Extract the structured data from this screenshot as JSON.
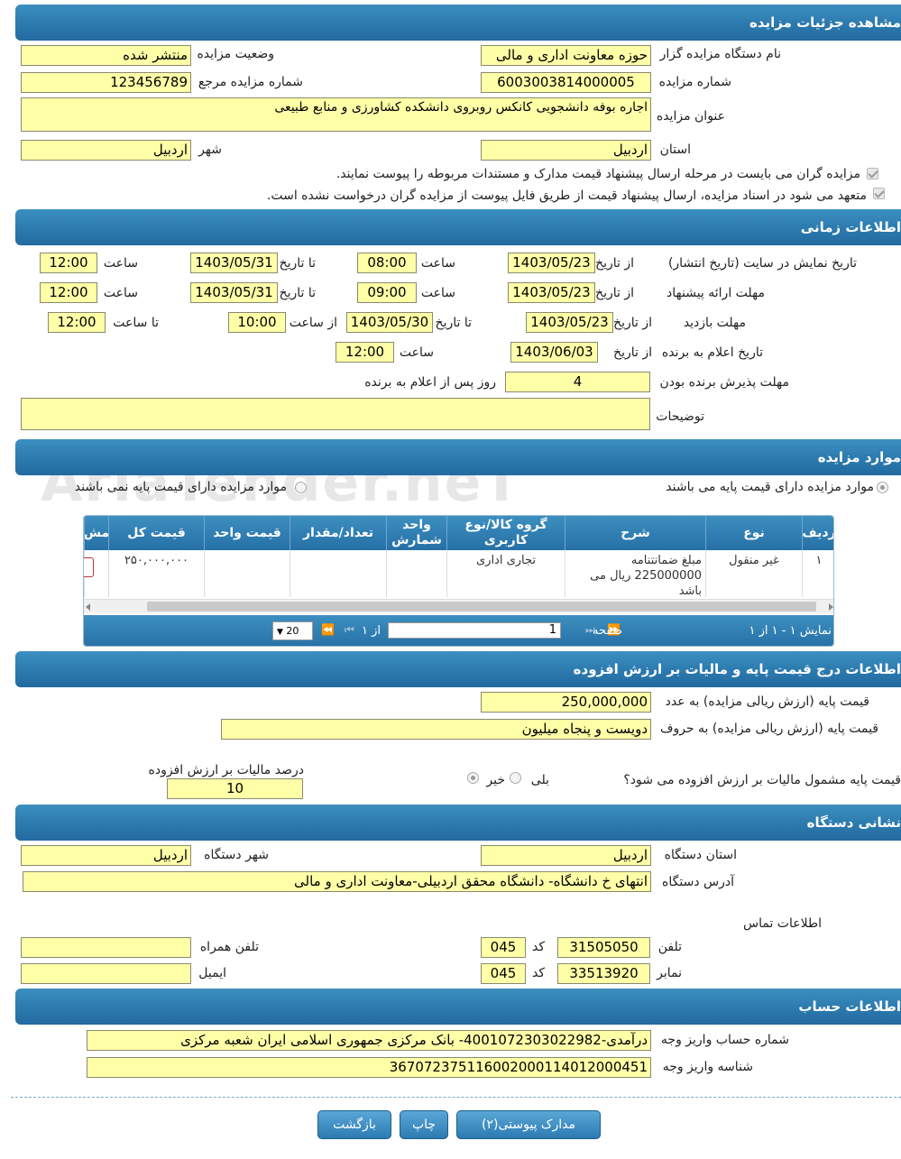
{
  "sections": {
    "details": "مشاهده جزئیات مزایده",
    "timing": "اطلاعات زمانی",
    "items": "موارد مزایده",
    "price": "اطلاعات درج قیمت پایه و مالیات بر ارزش افزوده",
    "address": "نشانی دستگاه",
    "account": "اطلاعات حساب"
  },
  "details": {
    "org_label": "نام دستگاه مزایده گزار",
    "org_value": "حوزه معاونت اداری و مالی",
    "status_label": "وضعیت مزایده",
    "status_value": "منتشر شده",
    "number_label": "شماره مزایده",
    "number_value": "6003003814000005",
    "ref_label": "شماره مزایده مرجع",
    "ref_value": "123456789",
    "title_label": "عنوان مزایده",
    "title_value": "اجاره بوفه دانشجویی کانکس روبروی دانشکده کشاورزی و منابع طبیعی",
    "province_label": "استان",
    "province_value": "اردبیل",
    "city_label": "شهر",
    "city_value": "اردبیل",
    "check1": "مزایده گران می بایست در مرحله ارسال پیشنهاد قیمت مدارک و مستندات مربوطه را پیوست نمایند.",
    "check2": "متعهد می شود در اسناد مزایده، ارسال پیشنهاد قیمت از طریق فایل پیوست از مزایده گران درخواست نشده است."
  },
  "timing": {
    "display_label": "تاریخ نمایش در سایت (تاریخ انتشار)",
    "offer_label": "مهلت ارائه پیشنهاد",
    "visit_label": "مهلت بازدید",
    "announce_label": "تاریخ اعلام به برنده",
    "accept_label": "مهلت پذیرش برنده بودن",
    "notes_label": "توضیحات",
    "from_date": "از تاریخ",
    "to_date": "تا تاریخ",
    "time": "ساعت",
    "from_time": "از ساعت",
    "to_time": "تا ساعت",
    "days_after": "روز پس از اعلام به برنده",
    "display_from": "1403/05/23",
    "display_from_time": "08:00",
    "display_to": "1403/05/31",
    "display_to_time": "12:00",
    "offer_from": "1403/05/23",
    "offer_from_time": "09:00",
    "offer_to": "1403/05/31",
    "offer_to_time": "12:00",
    "visit_from": "1403/05/23",
    "visit_to": "1403/05/30",
    "visit_from_time": "10:00",
    "visit_to_time": "12:00",
    "announce_from": "1403/06/03",
    "announce_time": "12:00",
    "accept_days": "4",
    "notes_value": ""
  },
  "items": {
    "radio_with_price": "موارد مزایده دارای قیمت پایه می باشند",
    "radio_without_price": "موارد مزایده دارای قیمت پایه نمی باشند",
    "columns": [
      "ردیف",
      "نوع",
      "شرح",
      "گروه کالا/نوع کاربری",
      "واحد شمارش",
      "تعداد/مقدار",
      "قیمت واحد",
      "قیمت کل",
      "مش"
    ],
    "rows": [
      {
        "row": "۱",
        "type": "غیر منقول",
        "desc": "مبلغ ضمانتنامه 225000000 ریال می باشد",
        "group": "تجاری اداری",
        "unit": "",
        "qty": "",
        "unit_price": "",
        "total": "۲۵۰,۰۰۰,۰۰۰"
      }
    ],
    "pager": {
      "showing": "نمایش ۱ - ۱ از ۱",
      "page_label": "صفحه",
      "page_value": "1",
      "of": "از ۱",
      "page_size": "20"
    }
  },
  "price": {
    "base_num_label": "قیمت پایه (ارزش ریالی مزایده) به عدد",
    "base_num_value": "250,000,000",
    "base_text_label": "قیمت پایه (ارزش ریالی مزایده) به حروف",
    "base_text_value": "دویست و پنجاه میلیون",
    "vat_question": "قیمت پایه مشمول مالیات بر ارزش افزوده می شود؟",
    "yes": "بلی",
    "no": "خیر",
    "vat_percent_label": "درصد مالیات بر ارزش افزوده",
    "vat_percent_value": "10"
  },
  "address": {
    "province_label": "استان دستگاه",
    "province_value": "اردبیل",
    "city_label": "شهر دستگاه",
    "city_value": "اردبیل",
    "address_label": "آدرس دستگاه",
    "address_value": "انتهای خ دانشگاه- دانشگاه محقق اردبیلی-معاونت اداری و مالی",
    "contact_label": "اطلاعات تماس",
    "phone_label": "تلفن",
    "phone_value": "31505050",
    "code_label": "کد",
    "phone_code": "045",
    "mobile_label": "تلفن همراه",
    "mobile_value": "",
    "fax_label": "نمابر",
    "fax_value": "33513920",
    "fax_code": "045",
    "email_label": "ایمیل",
    "email_value": ""
  },
  "account": {
    "account_label": "شماره حساب واریز وجه",
    "account_value": "درآمدی-4001072303022982- بانک مرکزی جمهوری اسلامی ایران شعبه مرکزی",
    "id_label": "شناسه واریز وجه",
    "id_value": "367072375116002000114012000451"
  },
  "buttons": {
    "attachments": "مدارک پیوستی(۲)",
    "print": "چاپ",
    "back": "بازگشت"
  },
  "watermark": "AriaTender.neT"
}
